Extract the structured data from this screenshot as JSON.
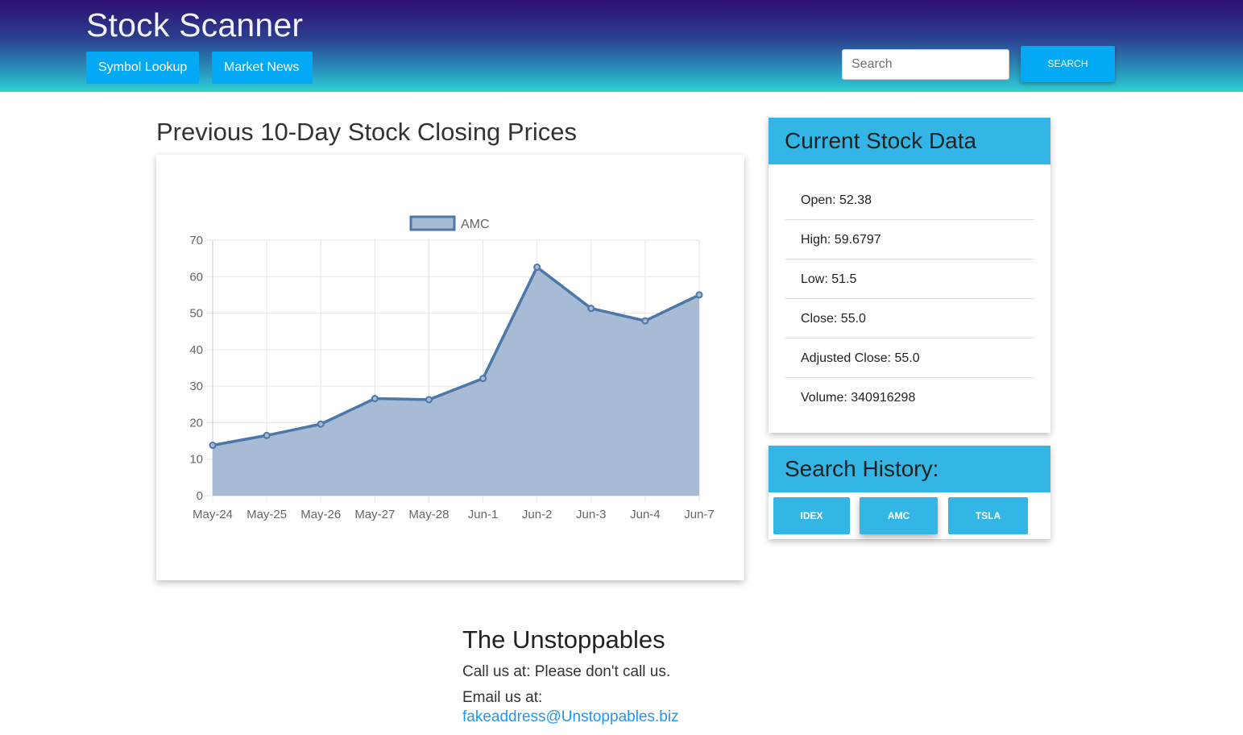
{
  "header": {
    "title": "Stock Scanner",
    "nav": [
      "Symbol Lookup",
      "Market News"
    ],
    "search_placeholder": "Search",
    "search_button": "SEARCH"
  },
  "chart_section": {
    "heading": "Previous 10-Day Stock Closing Prices"
  },
  "chart_data": {
    "type": "area",
    "categories": [
      "May-24",
      "May-25",
      "May-26",
      "May-27",
      "May-28",
      "Jun-1",
      "Jun-2",
      "Jun-3",
      "Jun-4",
      "Jun-7"
    ],
    "series": [
      {
        "name": "AMC",
        "values": [
          13.8,
          16.5,
          19.6,
          26.6,
          26.3,
          32.1,
          62.6,
          51.3,
          47.9,
          55.0
        ]
      }
    ],
    "yticks": [
      0,
      10,
      20,
      30,
      40,
      50,
      60,
      70
    ],
    "ylim": [
      0,
      70
    ],
    "grid": true,
    "legend": "top",
    "colors": {
      "line": "#4b77a9",
      "fill": "#a7bbd4",
      "grid": "#e6e6e6",
      "tick_text": "#666666"
    }
  },
  "current_stock": {
    "title": "Current Stock Data",
    "items": [
      "Open: 52.38",
      "High: 59.6797",
      "Low: 51.5",
      "Close: 55.0",
      "Adjusted Close: 55.0",
      "Volume: 340916298"
    ]
  },
  "search_history": {
    "title": "Search History:",
    "items": [
      "IDEX",
      "AMC",
      "TSLA"
    ]
  },
  "footer": {
    "title": "The Unstoppables",
    "call": "Call us at: Please don't call us.",
    "email_label": "Email us at:",
    "email": "fakeaddress@Unstoppables.biz"
  },
  "colors": {
    "accent": "#03a9f4",
    "panel_header": "#33b5e5",
    "link": "#2196f3"
  }
}
